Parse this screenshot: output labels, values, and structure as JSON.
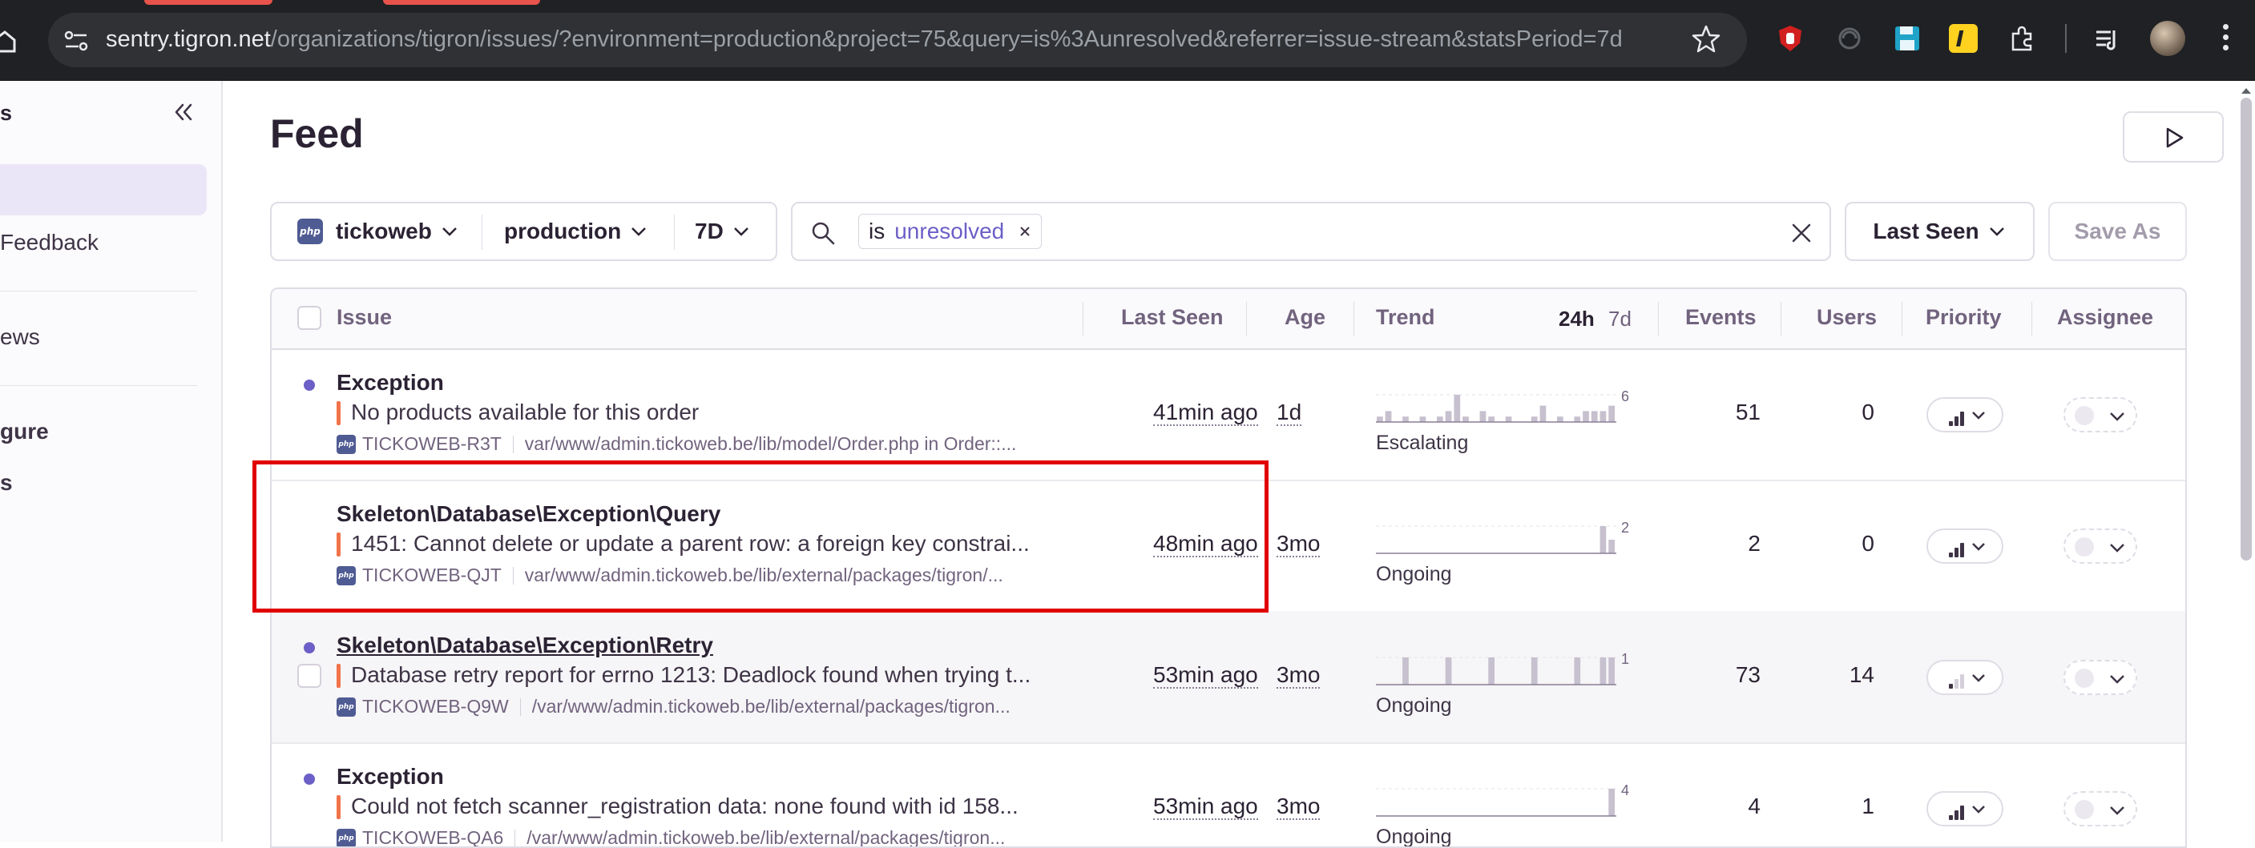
{
  "browser": {
    "url_host": "sentry.tigron.net",
    "url_path": "/organizations/tigron/issues/?environment=production&project=75&query=is%3Aunresolved&referrer=issue-stream&statsPeriod=7d",
    "extensions": [
      "ublock-icon",
      "disabled-extension-icon",
      "save-icon",
      "extension-i-icon",
      "puzzle-icon",
      "media-icon"
    ]
  },
  "sidebar": {
    "title": "s",
    "items": [
      {
        "label": "Feedback",
        "bold": false
      },
      {
        "label": "ews",
        "bold": false
      },
      {
        "label": "gure",
        "bold": true
      },
      {
        "label": "s",
        "bold": true
      }
    ]
  },
  "main": {
    "title": "Feed",
    "filters": {
      "project": "tickoweb",
      "environment": "production",
      "period": "7D"
    },
    "search": {
      "token_operator": "is",
      "token_value": "unresolved"
    },
    "sort_label": "Last Seen",
    "save_as_label": "Save As"
  },
  "table": {
    "headers": {
      "issue": "Issue",
      "last_seen": "Last Seen",
      "age": "Age",
      "trend": "Trend",
      "period_24h": "24h",
      "period_7d": "7d",
      "events": "Events",
      "users": "Users",
      "priority": "Priority",
      "assignee": "Assignee"
    },
    "rows": [
      {
        "title": "Exception",
        "message": "No products available for this order",
        "short_id": "TICKOWEB-R3T",
        "culprit": "var/www/admin.tickoweb.be/lib/model/Order.php in Order::...",
        "last_seen": "41min ago",
        "age": "1d",
        "trend_label": "Escalating",
        "trend_max": "6",
        "trend_values": [
          1,
          2,
          0,
          1,
          0,
          1,
          0,
          1,
          2,
          5,
          1,
          0,
          2,
          1,
          0,
          1,
          0,
          0,
          1,
          3,
          0,
          1,
          0,
          1,
          2,
          2,
          2,
          3
        ],
        "events": "51",
        "users": "0",
        "priority_level": "high"
      },
      {
        "title": "Skeleton\\Database\\Exception\\Query",
        "message": "1451: Cannot delete or update a parent row: a foreign key constrai...",
        "short_id": "TICKOWEB-QJT",
        "culprit": "var/www/admin.tickoweb.be/lib/external/packages/tigron/...",
        "last_seen": "48min ago",
        "age": "3mo",
        "trend_label": "Ongoing",
        "trend_max": "2",
        "trend_values": [
          0,
          0,
          0,
          0,
          0,
          0,
          0,
          0,
          0,
          0,
          0,
          0,
          0,
          0,
          0,
          0,
          0,
          0,
          0,
          0,
          0,
          0,
          0,
          0,
          0,
          0,
          2,
          1
        ],
        "events": "2",
        "users": "0",
        "priority_level": "high"
      },
      {
        "title": "Skeleton\\Database\\Exception\\Retry",
        "message": "Database retry report for errno 1213: Deadlock found when trying t...",
        "short_id": "TICKOWEB-Q9W",
        "culprit": "/var/www/admin.tickoweb.be/lib/external/packages/tigron...",
        "last_seen": "53min ago",
        "age": "3mo",
        "trend_label": "Ongoing",
        "trend_max": "1",
        "trend_values": [
          0,
          0,
          0,
          1,
          0,
          0,
          0,
          0,
          1,
          0,
          0,
          0,
          0,
          1,
          0,
          0,
          0,
          0,
          1,
          0,
          0,
          0,
          0,
          1,
          0,
          0,
          1,
          1
        ],
        "events": "73",
        "users": "14",
        "priority_level": "low"
      },
      {
        "title": "Exception",
        "message": "Could not fetch scanner_registration data: none found with id 158...",
        "short_id": "TICKOWEB-QA6",
        "culprit": "/var/www/admin.tickoweb.be/lib/external/packages/tigron...",
        "last_seen": "53min ago",
        "age": "3mo",
        "trend_label": "Ongoing",
        "trend_max": "4",
        "trend_values": [
          0,
          0,
          0,
          0,
          0,
          0,
          0,
          0,
          0,
          0,
          0,
          0,
          0,
          0,
          0,
          0,
          0,
          0,
          0,
          0,
          0,
          0,
          0,
          0,
          0,
          0,
          0,
          4
        ],
        "events": "4",
        "users": "1",
        "priority_level": "high"
      }
    ]
  },
  "colors": {
    "accent": "#6c5fc7",
    "highlight_box": "#e00000",
    "error_bar": "#f2734a"
  }
}
